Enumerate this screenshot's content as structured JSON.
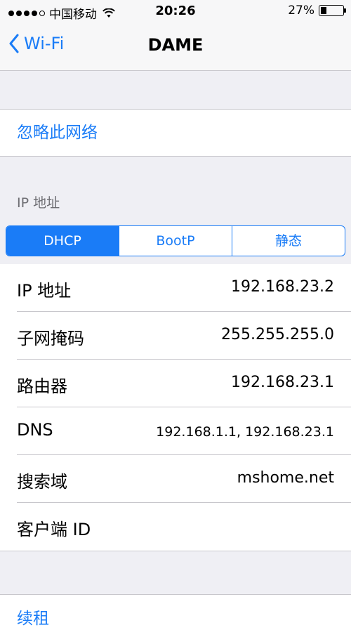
{
  "status_bar": {
    "carrier": "中国移动",
    "time": "20:26",
    "battery_percent": "27%",
    "battery_level": 0.27,
    "signal_bars": 4
  },
  "nav": {
    "back_label": "Wi-Fi",
    "title": "DAME"
  },
  "forget_network": "忽略此网络",
  "ip_section": {
    "header": "IP 地址",
    "segments": [
      "DHCP",
      "BootP",
      "静态"
    ],
    "selected": "DHCP"
  },
  "rows": [
    {
      "label": "IP 地址",
      "value": "192.168.23.2"
    },
    {
      "label": "子网掩码",
      "value": "255.255.255.0"
    },
    {
      "label": "路由器",
      "value": "192.168.23.1"
    },
    {
      "label": "DNS",
      "value": "192.168.1.1, 192.168.23.1"
    },
    {
      "label": "搜索域",
      "value": "mshome.net"
    },
    {
      "label": "客户端 ID",
      "value": ""
    }
  ],
  "renew_label": "续租",
  "colors": {
    "accent": "#1a7cf7",
    "background": "#efeff4"
  }
}
